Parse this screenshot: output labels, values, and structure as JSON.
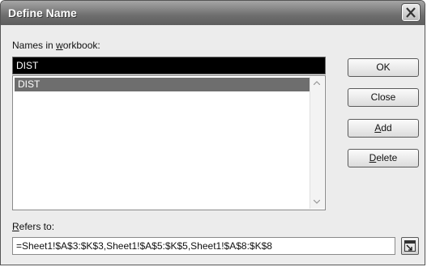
{
  "window": {
    "title": "Define Name"
  },
  "names_label": {
    "pre": "Names in ",
    "key": "w",
    "post": "orkbook:"
  },
  "name_value": "DIST",
  "list": {
    "items": [
      "DIST"
    ]
  },
  "buttons": {
    "ok": {
      "pre": "",
      "key": "",
      "post": "OK"
    },
    "close": {
      "pre": "Close",
      "key": "",
      "post": ""
    },
    "add": {
      "pre": "",
      "key": "A",
      "post": "dd"
    },
    "delete": {
      "pre": "",
      "key": "D",
      "post": "elete"
    }
  },
  "refers_label": {
    "pre": "",
    "key": "R",
    "post": "efers to:"
  },
  "refers_value": "=Sheet1!$A$3:$K$3,Sheet1!$A$5:$K$5,Sheet1!$A$8:$K$8",
  "icons": {
    "close": "close-x-icon",
    "scroll_up": "chevron-up-icon",
    "scroll_down": "chevron-down-icon",
    "collapse": "collapse-dialog-icon"
  }
}
